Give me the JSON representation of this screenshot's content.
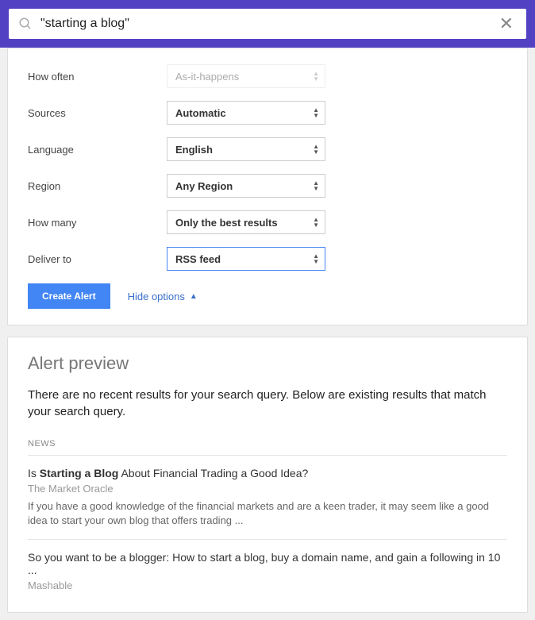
{
  "search": {
    "value": "\"starting a blog\""
  },
  "options": {
    "how_often": {
      "label": "How often",
      "value": "As-it-happens"
    },
    "sources": {
      "label": "Sources",
      "value": "Automatic"
    },
    "language": {
      "label": "Language",
      "value": "English"
    },
    "region": {
      "label": "Region",
      "value": "Any Region"
    },
    "how_many": {
      "label": "How many",
      "value": "Only the best results"
    },
    "deliver_to": {
      "label": "Deliver to",
      "value": "RSS feed"
    }
  },
  "actions": {
    "create": "Create Alert",
    "hide_options": "Hide options"
  },
  "preview": {
    "title": "Alert preview",
    "message": "There are no recent results for your search query. Below are existing results that match your search query.",
    "section": "NEWS",
    "results": [
      {
        "title_prefix": "Is ",
        "title_bold": "Starting a Blog",
        "title_suffix": " About Financial Trading a Good Idea?",
        "source": "The Market Oracle",
        "snippet": "If you have a good knowledge of the financial markets and are a keen trader, it may seem like a good idea to start your own blog that offers trading ..."
      },
      {
        "title_prefix": "So you want to be a blogger: How to start a blog, buy a domain name, and gain a following in 10 ...",
        "title_bold": "",
        "title_suffix": "",
        "source": "Mashable",
        "snippet": ""
      }
    ]
  }
}
